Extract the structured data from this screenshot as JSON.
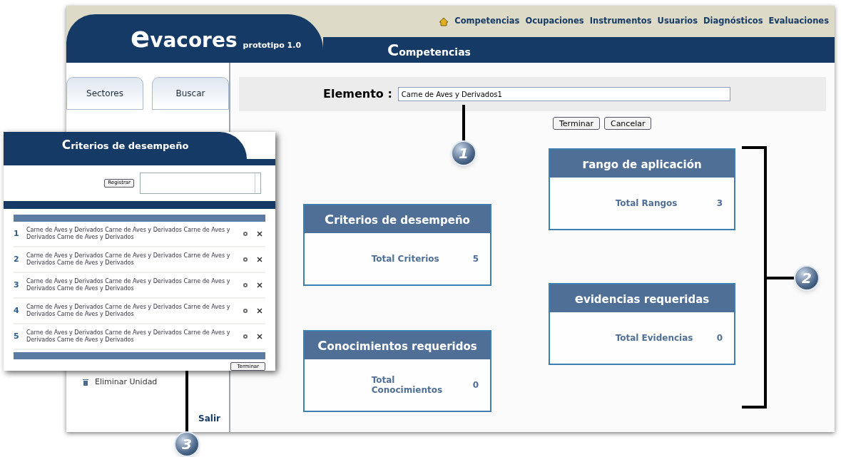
{
  "header": {
    "logo": "evacores",
    "version": "prototipo 1.0",
    "nav": [
      "Competencias",
      "Ocupaciones",
      "Instrumentos",
      "Usuarios",
      "Diagnósticos",
      "Evaluaciones"
    ],
    "section": "Competencias"
  },
  "sidebar": {
    "tabs": [
      "Sectores",
      "Buscar"
    ],
    "items": [
      "Eliminar Unidad"
    ],
    "exit": "Salir"
  },
  "form": {
    "label": "Elemento :",
    "value": "Carne de Aves y Derivados1",
    "buttons": [
      "Terminar",
      "Cancelar"
    ]
  },
  "left_panels": [
    {
      "title": "Criterios de desempeño",
      "label": "Total Criterios",
      "value": "5"
    },
    {
      "title": "Conocimientos requeridos",
      "label": "Total Conocimientos",
      "value": "0"
    }
  ],
  "right_panels": [
    {
      "title": "rango de aplicación",
      "label": "Total Rangos",
      "value": "3"
    },
    {
      "title": "evidencias requeridas",
      "label": "Total Evidencias",
      "value": "0"
    }
  ],
  "popup": {
    "title": "Criterios de desempeño",
    "register": "Registrar",
    "finish": "Terminar",
    "rows": [
      {
        "number": "1",
        "text": "Carne de Aves y Derivados Carne de Aves y Derivados Carne de Aves y Derivados Carne de Aves y Derivados"
      },
      {
        "number": "2",
        "text": "Carne de Aves y Derivados Carne de Aves y Derivados Carne de Aves y Derivados Carne de Aves y Derivados"
      },
      {
        "number": "3",
        "text": "Carne de Aves y Derivados Carne de Aves y Derivados Carne de Aves y Derivados Carne de Aves y Derivados"
      },
      {
        "number": "4",
        "text": "Carne de Aves y Derivados Carne de Aves y Derivados Carne de Aves y Derivados Carne de Aves y Derivados"
      },
      {
        "number": "5",
        "text": "Carne de Aves y Derivados Carne de Aves y Derivados Carne de Aves y Derivados Carne de Aves y Derivados"
      }
    ]
  },
  "callouts": [
    "1",
    "2",
    "3"
  ]
}
